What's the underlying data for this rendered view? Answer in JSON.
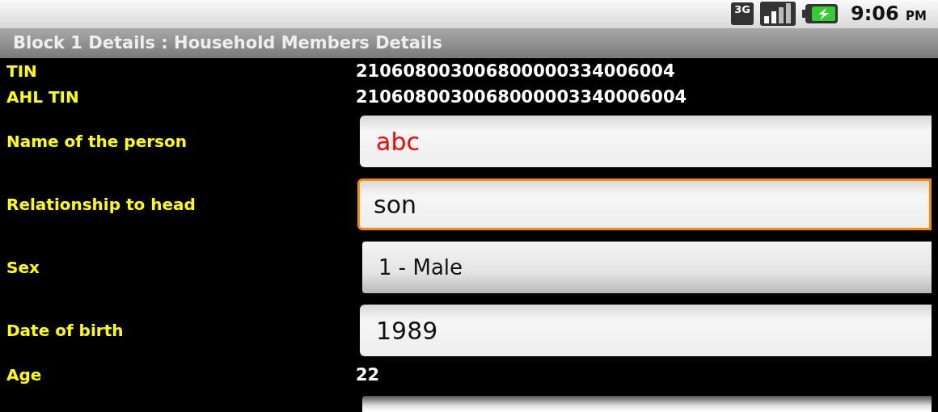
{
  "status_bar": {
    "network_type": "3G",
    "time": "9:06",
    "time_suffix": "PM"
  },
  "window": {
    "title": "Block 1 Details : Household Members Details"
  },
  "rows": [
    {
      "kind": "text",
      "label": "TIN",
      "value": "210608003006800000334006004"
    },
    {
      "kind": "text",
      "label": "AHL TIN",
      "value": "2106080030068000003340006004"
    },
    {
      "kind": "input",
      "label": "Name of the person",
      "value": "abc",
      "invalid": true,
      "focused": false
    },
    {
      "kind": "input",
      "label": "Relationship to head",
      "value": "son",
      "invalid": false,
      "focused": true
    },
    {
      "kind": "spinner",
      "label": "Sex",
      "value": "1 - Male"
    },
    {
      "kind": "input",
      "label": "Date of birth",
      "value": "1989",
      "invalid": false,
      "focused": false
    },
    {
      "kind": "text",
      "label": "Age",
      "value": "22"
    },
    {
      "kind": "partial"
    }
  ]
}
